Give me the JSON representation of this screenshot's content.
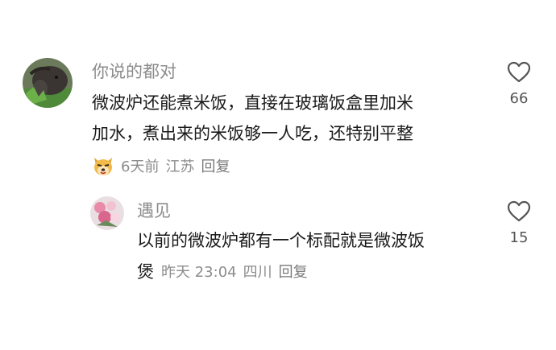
{
  "comments": [
    {
      "username": "你说的都对",
      "text_lines": [
        "微波炉还能煮米饭，直接在玻璃饭盒里加米",
        "加水，煮出来的米饭够一人吃，还特别平整"
      ],
      "emoji_icon": "dog-face-emoji-icon",
      "time": "6天前",
      "location": "江苏",
      "reply_label": "回复",
      "like_count": "66",
      "like_icon": "heart-outline-icon"
    },
    {
      "username": "遇见",
      "text_lines": [
        "以前的微波炉都有一个标配就是微波饭",
        "煲"
      ],
      "time": "昨天 23:04",
      "location": "四川",
      "reply_label": "回复",
      "like_count": "15",
      "like_icon": "heart-outline-icon"
    }
  ],
  "colors": {
    "username": "#8c8c8c",
    "text": "#1a1a1a",
    "meta": "#8c8c8c",
    "icon": "#555555"
  }
}
